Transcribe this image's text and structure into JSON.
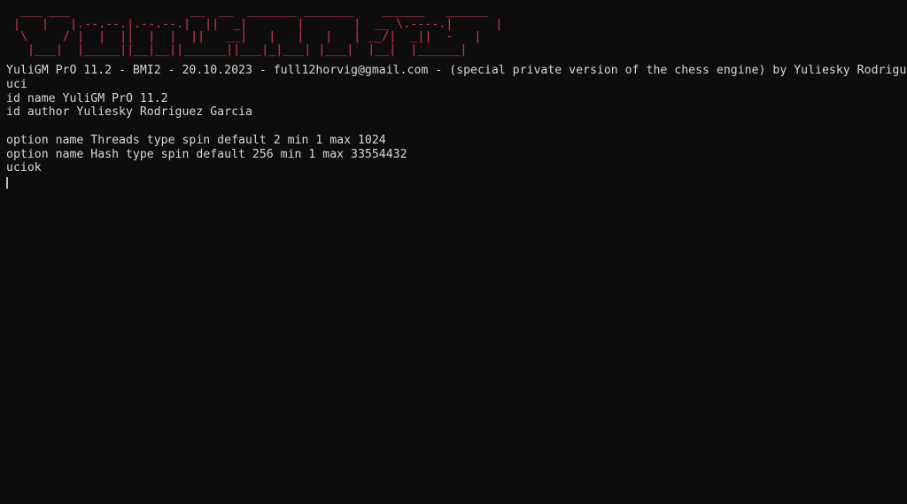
{
  "terminal": {
    "background_color": "#0d0d0d",
    "text_color": "#d6d6d6",
    "banner_color": "#c9364a",
    "cursor_color": "#bdbdbd",
    "banner_ascii_art": "  ___  ___        _ _  ___ __  __       ______           ____\n |   |   |.--.--.| ||   |  \\/  |     |   _  \\.----.|    |\n  \\     / |  |  || ||   |       |     |     _/|   _||  -   |\n   |___|  |_____||_||___|__|_|__|     |___|  |__|  |______|",
    "banner_lines": [
      "  ___ ___                 __  __  _______ _______    ______   ______",
      " |   |   |.--.--.|.--.--.|  ||  _|       |       |  __ \\.----.|      |",
      "  \\     / |  |  ||  |  |  ||   __|   |   |   |   | __/|  _||  -   |",
      "   |___|  |_____||__|__||______||___|_|___| |___|  |__|  |______|"
    ],
    "output_lines": [
      "YuliGM PrO 11.2 - BMI2 - 20.10.2023 - full12horvig@gmail.com - (special private version of the chess engine) by Yuliesky Rodriguez Garcia",
      "uci",
      "id name YuliGM PrO 11.2",
      "id author Yuliesky Rodriguez Garcia",
      "",
      "option name Threads type spin default 2 min 1 max 1024",
      "option name Hash type spin default 256 min 1 max 33554432",
      "uciok"
    ],
    "engine": {
      "name": "YuliGM PrO",
      "version": "11.2",
      "build": "BMI2",
      "date": "20.10.2023",
      "contact": "full12horvig@gmail.com",
      "description": "(special private version of the chess engine)",
      "author": "Yuliesky Rodriguez Garcia"
    },
    "uci_options": [
      {
        "name": "Threads",
        "type": "spin",
        "default": "2",
        "min": "1",
        "max": "1024"
      },
      {
        "name": "Hash",
        "type": "spin",
        "default": "256",
        "min": "1",
        "max": "33554432"
      }
    ],
    "command_entered": "uci",
    "status": "uciok",
    "prompt_cursor": ""
  }
}
